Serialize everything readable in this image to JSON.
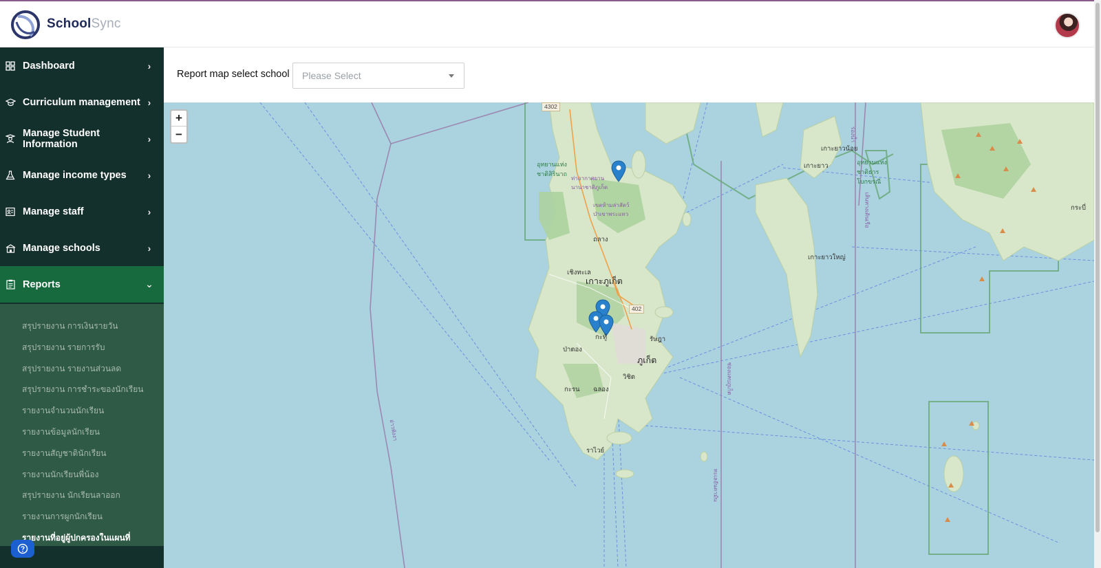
{
  "app": {
    "brand_part1": "School",
    "brand_part2": "Sync"
  },
  "sidebar": {
    "items": [
      {
        "label": "Dashboard",
        "icon": "grid-icon"
      },
      {
        "label": "Curriculum management",
        "icon": "graduation-cap-icon"
      },
      {
        "label": "Manage Student Information",
        "icon": "student-icon"
      },
      {
        "label": "Manage income types",
        "icon": "flask-icon"
      },
      {
        "label": "Manage staff",
        "icon": "staff-id-icon"
      },
      {
        "label": "Manage schools",
        "icon": "school-building-icon"
      },
      {
        "label": "Reports",
        "icon": "clipboard-icon"
      }
    ],
    "reports_submenu": [
      "สรุปรายงาน การเงินรายวัน",
      "สรุปรายงาน รายการรับ",
      "สรุปรายงาน รายงานส่วนลด",
      "สรุปรายงาน การชำระของนักเรียน",
      "รายงานจำนวนนักเรียน",
      "รายงานข้อมูลนักเรียน",
      "รายงานสัญชาตินักเรียน",
      "รายงานนักเรียนพี่น้อง",
      "สรุปรายงาน นักเรียนลาออก",
      "รายงานการผูกนักเรียน",
      "รายงานที่อยู่ผู้ปกครองในแผนที่"
    ]
  },
  "filter": {
    "label": "Report map select school :",
    "placeholder": "Please Select"
  },
  "map": {
    "zoom_in": "+",
    "zoom_out": "−",
    "labels": {
      "island": "เกาะภูเก็ต",
      "phuket_town": "ภูเก็ต",
      "kathu": "กะทู้",
      "rawai": "ราไวย์",
      "thalang": "ถลาง",
      "cherngtalay": "เชิงทะเล",
      "patong": "ป่าตอง",
      "wichit": "วิชิต",
      "karon": "กะรน",
      "chalong": "ฉลอง",
      "rassada": "รัษฎา",
      "yao_yai": "เกาะยาวใหญ่",
      "yao_noi": "เกาะยาวน้อย",
      "koh_yao": "เกาะยาว",
      "krabi": "กระบี่",
      "park_sirinat": "อุทยานแห่งชาติสิรินาถ",
      "park_tharnbok": "อุทยานแห่งชาติธารโบกขรณี",
      "airport": "ท่าอากาศยานนานาชาติภูเก็ต",
      "wildlife": "เขตห้ามล่าสัตว์ป่าเขาพระแทว",
      "route_4302": "4302",
      "route_402": "402",
      "vertical_1": "อ่าวพังงา",
      "vertical_2": "ช่องแคบภูเก็ต",
      "vertical_3": "ทะเลอันดามัน",
      "vertical_4": "ร่องน้ำ",
      "vertical_5": "เส้นทางเดินเรือ"
    },
    "markers_count": 4
  }
}
